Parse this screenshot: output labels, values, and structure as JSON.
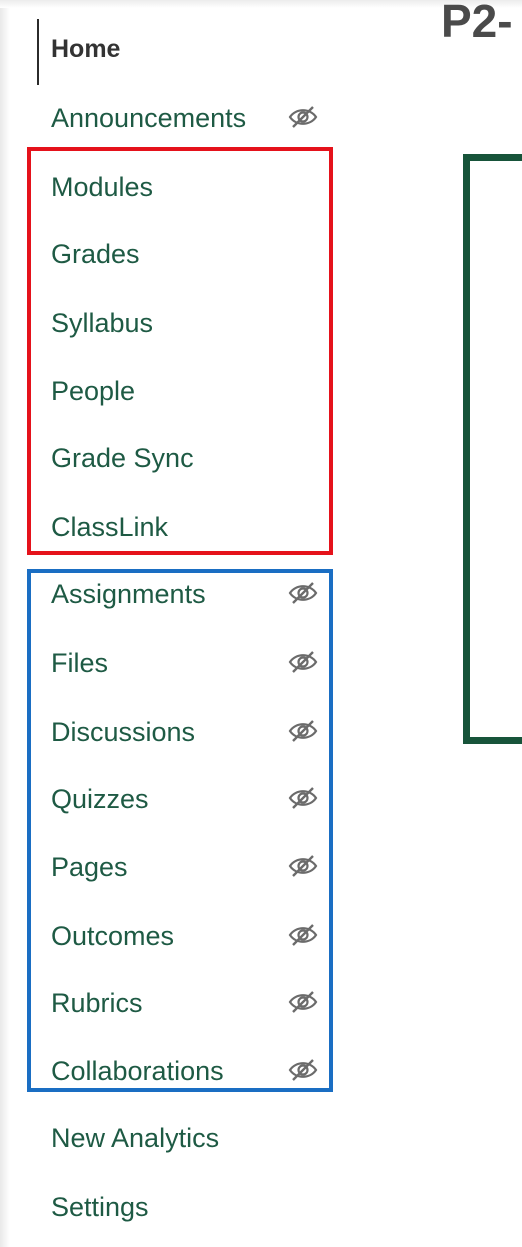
{
  "page_title": "P2-",
  "nav": {
    "items": [
      {
        "label": "Home",
        "active": true,
        "hidden": false
      },
      {
        "label": "Announcements",
        "hidden": true
      },
      {
        "label": "Modules",
        "hidden": false
      },
      {
        "label": "Grades",
        "hidden": false
      },
      {
        "label": "Syllabus",
        "hidden": false
      },
      {
        "label": "People",
        "hidden": false
      },
      {
        "label": "Grade Sync",
        "hidden": false
      },
      {
        "label": "ClassLink",
        "hidden": false
      },
      {
        "label": "Assignments",
        "hidden": true
      },
      {
        "label": "Files",
        "hidden": true
      },
      {
        "label": "Discussions",
        "hidden": true
      },
      {
        "label": "Quizzes",
        "hidden": true
      },
      {
        "label": "Pages",
        "hidden": true
      },
      {
        "label": "Outcomes",
        "hidden": true
      },
      {
        "label": "Rubrics",
        "hidden": true
      },
      {
        "label": "Collaborations",
        "hidden": true
      },
      {
        "label": "New Analytics",
        "hidden": false
      },
      {
        "label": "Settings",
        "hidden": false
      }
    ],
    "hidden_icon": "eye-slash-icon"
  },
  "colors": {
    "nav_link": "#1e5a44",
    "highlight_red": "#e5121b",
    "highlight_blue": "#1a6ec3",
    "frame_green": "#17543a"
  }
}
